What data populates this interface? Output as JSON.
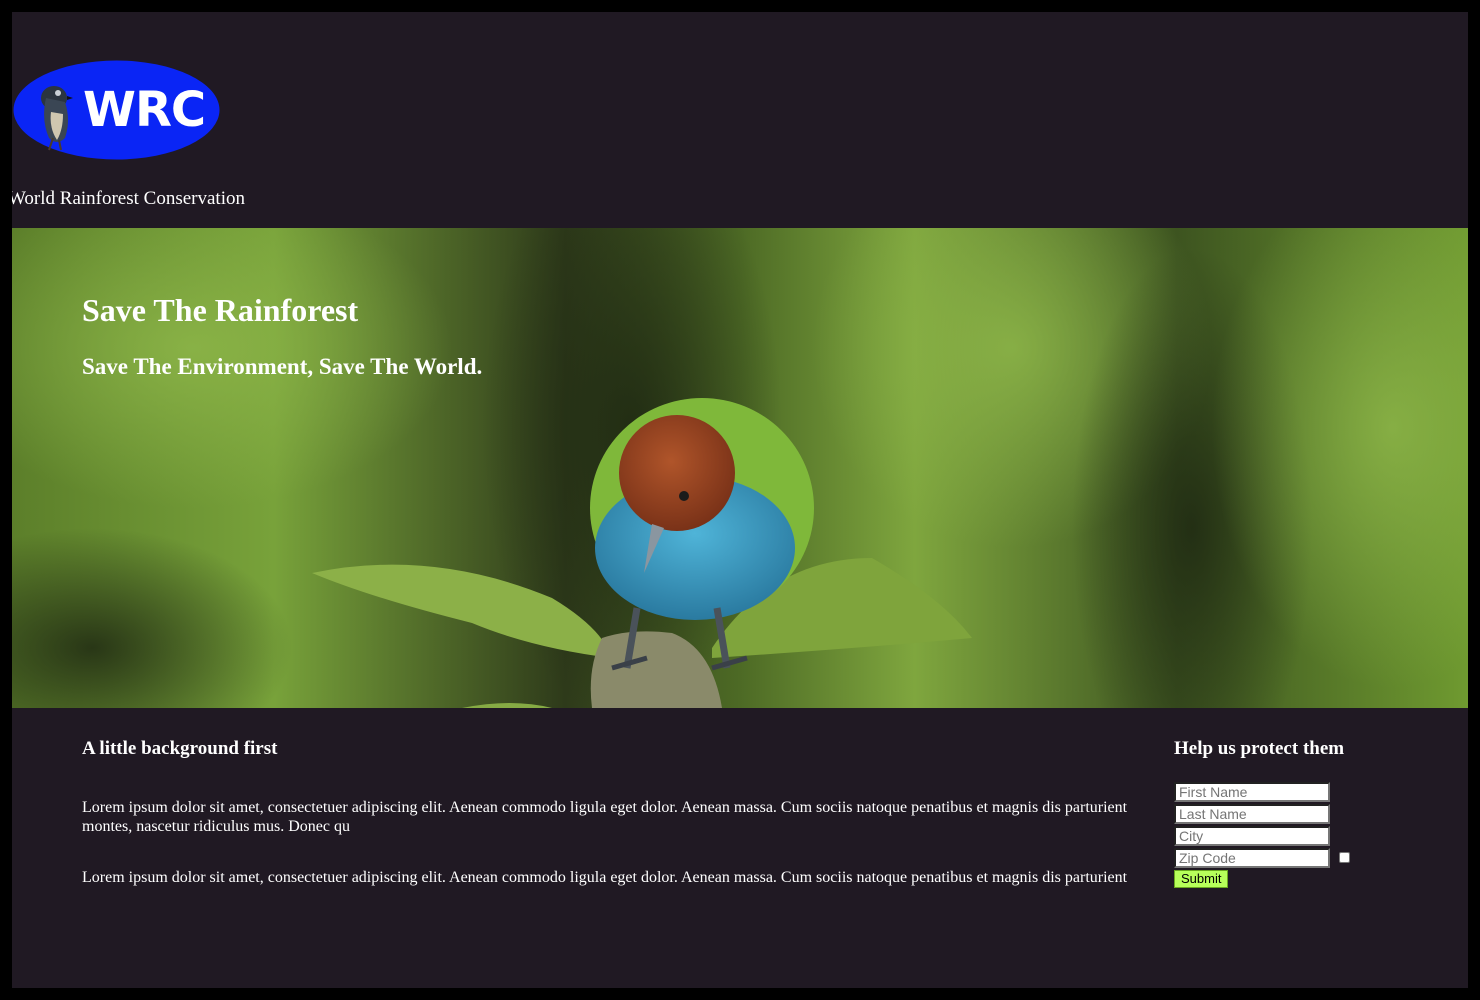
{
  "header": {
    "logo_text": "WRC",
    "site_name": "World Rainforest Conservation"
  },
  "hero": {
    "title": "Save The Rainforest",
    "subtitle": "Save The Environment, Save The World."
  },
  "background_section": {
    "heading": "A little background first",
    "paragraphs": [
      "Lorem ipsum dolor sit amet, consectetuer adipiscing elit. Aenean commodo ligula eget dolor. Aenean massa. Cum sociis natoque penatibus et magnis dis parturient montes, nascetur ridiculus mus. Donec qu",
      "Lorem ipsum dolor sit amet, consectetuer adipiscing elit. Aenean commodo ligula eget dolor. Aenean massa. Cum sociis natoque penatibus et magnis dis parturient"
    ]
  },
  "signup": {
    "heading": "Help us protect them",
    "first_name_placeholder": "First Name",
    "last_name_placeholder": "Last Name",
    "city_placeholder": "City",
    "zip_placeholder": "Zip Code",
    "submit_label": "Submit",
    "checkbox_checked": false
  },
  "colors": {
    "page_background": "#201923",
    "logo_oval": "#0a25f5",
    "submit_button": "#b7ff5a",
    "hero_foliage": "#6f9a30"
  },
  "icons": {
    "logo_mascot": "bird-icon",
    "hero_image": "tanager-bird-on-leaves"
  }
}
